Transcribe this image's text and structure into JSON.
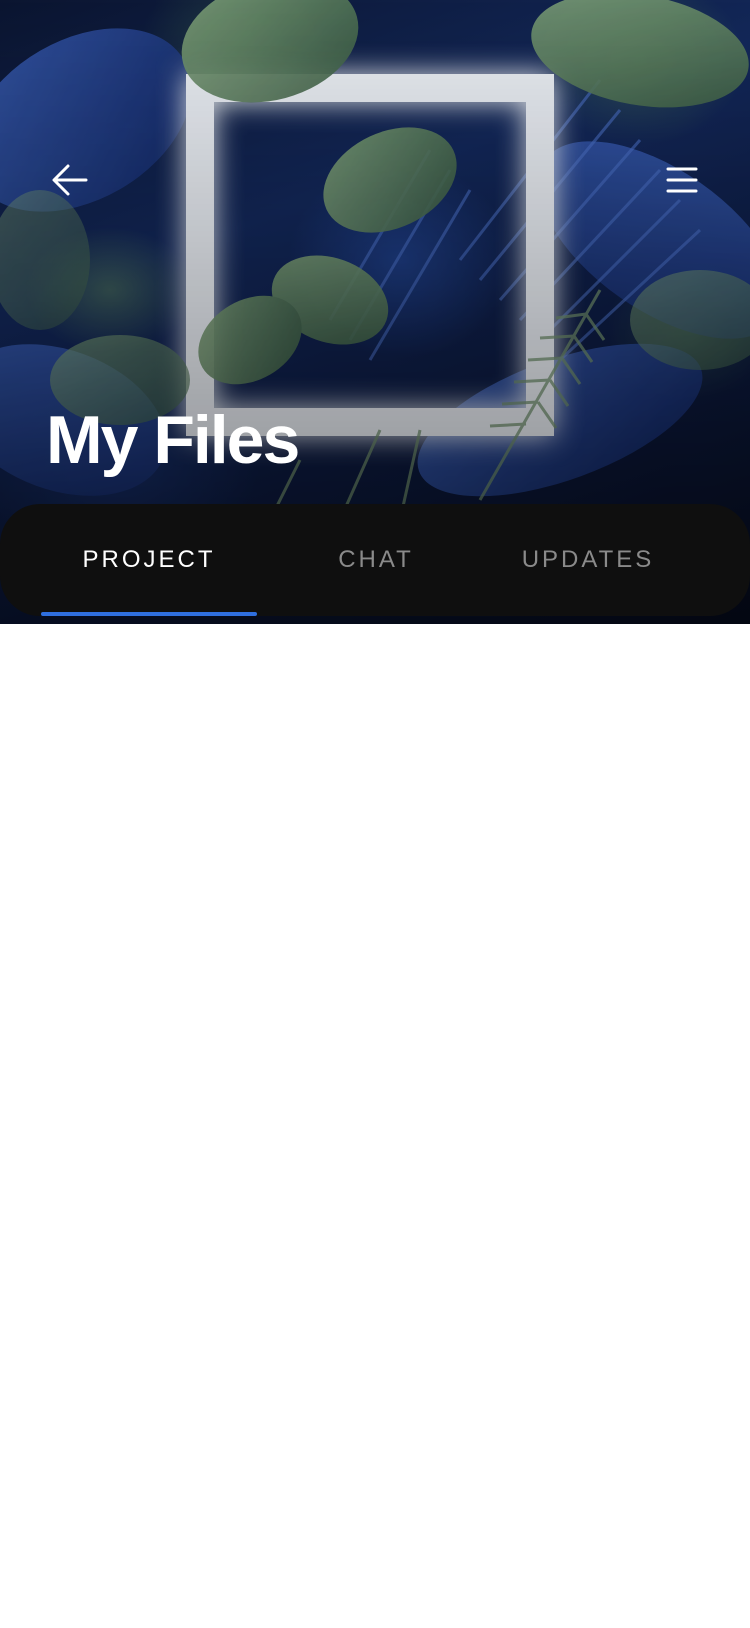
{
  "header": {
    "title": "My Files",
    "back_icon": "arrow-left-icon",
    "menu_icon": "hamburger-menu-icon"
  },
  "tabs": [
    {
      "label": "PROJECT",
      "active": true
    },
    {
      "label": "CHAT",
      "active": false
    },
    {
      "label": "UPDATES",
      "active": false
    }
  ],
  "colors": {
    "tab_bar_background": "#0f0f0f",
    "active_tab_text": "#ffffff",
    "inactive_tab_text": "#8a8a8a",
    "active_tab_indicator": "#2f6fe0",
    "content_background": "#ffffff"
  }
}
